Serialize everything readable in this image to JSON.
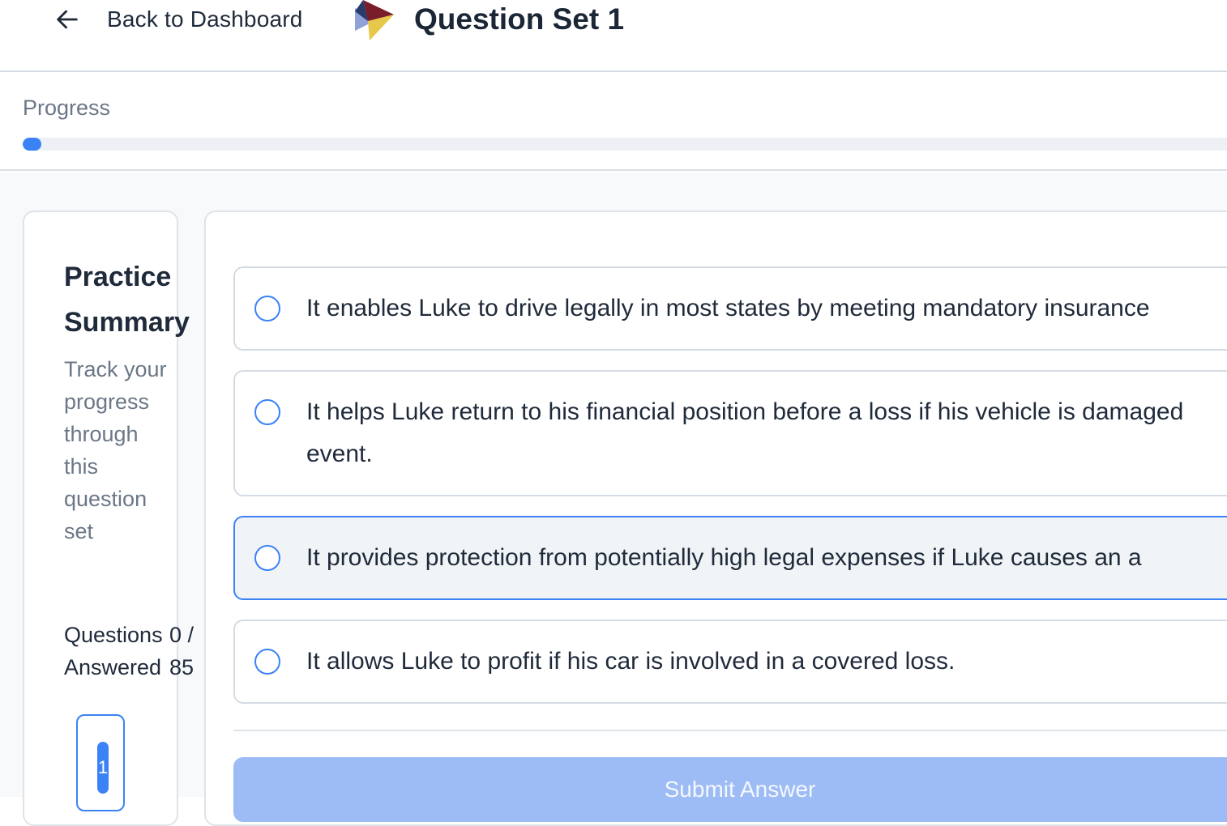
{
  "header": {
    "back_label": "Back to Dashboard",
    "title": "Question Set 1",
    "back_icon": "arrow-left-icon",
    "logo_icon": "triangle-logo"
  },
  "progress": {
    "label": "Progress",
    "value_fraction": 0.015,
    "fill_color": "#3b82f6"
  },
  "summary": {
    "title": "Practice Summary",
    "description": "Track your progress through this question set",
    "stat_label": "Questions Answered",
    "stat_value": "0 / 85",
    "current_question": "1"
  },
  "options": [
    {
      "text": "It enables Luke to drive legally in most states by meeting mandatory insurance"
    },
    {
      "text": "It helps Luke return to his financial position before a loss if his vehicle is damaged event."
    },
    {
      "text": "It provides protection from potentially high legal expenses if Luke causes an a"
    },
    {
      "text": "It allows Luke to profit if his car is involved in a covered loss."
    }
  ],
  "submit": {
    "label": "Submit Answer"
  },
  "colors": {
    "accent": "#3b82f6",
    "submit_disabled": "#9dbcf5"
  }
}
